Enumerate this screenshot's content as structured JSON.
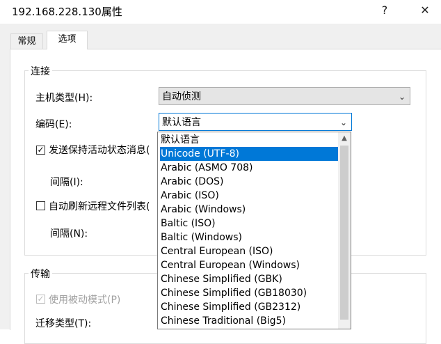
{
  "window": {
    "title": "192.168.228.130属性",
    "help_glyph": "?",
    "close_glyph": "✕"
  },
  "tabs": [
    {
      "label": "常规"
    },
    {
      "label": "选项"
    }
  ],
  "connection": {
    "group_label": "连接",
    "host_type_label": "主机类型(H):",
    "host_type_value": "自动侦测",
    "encoding_label": "编码(E):",
    "encoding_value": "默认语言",
    "keepalive_label": "发送保持活动状态消息(",
    "keepalive_checked": true,
    "interval1_label": "间隔(I):",
    "refresh_label": "自动刷新远程文件列表(",
    "refresh_checked": false,
    "interval2_label": "间隔(N):"
  },
  "transfer": {
    "group_label": "传输",
    "passive_label": "使用被动模式(P)",
    "passive_checked": true,
    "migrate_label": "迁移类型(T):"
  },
  "encoding_options": [
    "默认语言",
    "Unicode (UTF-8)",
    "Arabic (ASMO 708)",
    "Arabic (DOS)",
    "Arabic (ISO)",
    "Arabic (Windows)",
    "Baltic (ISO)",
    "Baltic (Windows)",
    "Central European (ISO)",
    "Central European (Windows)",
    "Chinese Simplified (GBK)",
    "Chinese Simplified (GB18030)",
    "Chinese Simplified (GB2312)",
    "Chinese Traditional (Big5)"
  ],
  "selected_option": "Unicode (UTF-8)",
  "icons": {
    "chevron": "⌄",
    "check": "✓",
    "scroll_up": "▲"
  },
  "colors": {
    "selection": "#0078d7",
    "dialog_bg": "#f0f0f0"
  }
}
